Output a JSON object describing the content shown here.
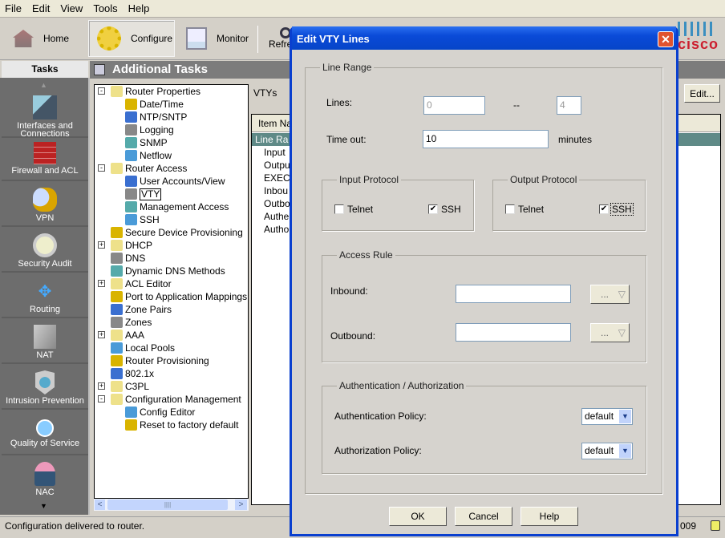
{
  "menu": [
    "File",
    "Edit",
    "View",
    "Tools",
    "Help"
  ],
  "toolbar": {
    "home": "Home",
    "configure": "Configure",
    "monitor": "Monitor",
    "refresh": "Refresh"
  },
  "logo": "cisco",
  "tasks_header": "Tasks",
  "sidebar": [
    {
      "label": "Interfaces and Connections",
      "icon": "interfaces-icon"
    },
    {
      "label": "Firewall and ACL",
      "icon": "firewall-icon"
    },
    {
      "label": "VPN",
      "icon": "vpn-icon"
    },
    {
      "label": "Security Audit",
      "icon": "security-audit-icon"
    },
    {
      "label": "Routing",
      "icon": "routing-icon"
    },
    {
      "label": "NAT",
      "icon": "nat-icon"
    },
    {
      "label": "Intrusion Prevention",
      "icon": "ips-icon"
    },
    {
      "label": "Quality of Service",
      "icon": "qos-icon"
    },
    {
      "label": "NAC",
      "icon": "nac-icon"
    }
  ],
  "panel_title": "Additional Tasks",
  "tree": [
    {
      "label": "Router Properties",
      "level": 0,
      "expander": "-"
    },
    {
      "label": "Date/Time",
      "level": 1
    },
    {
      "label": "NTP/SNTP",
      "level": 1
    },
    {
      "label": "Logging",
      "level": 1
    },
    {
      "label": "SNMP",
      "level": 1
    },
    {
      "label": "Netflow",
      "level": 1
    },
    {
      "label": "Router Access",
      "level": 0,
      "expander": "-"
    },
    {
      "label": "User Accounts/View",
      "level": 1
    },
    {
      "label": "VTY",
      "level": 1,
      "selected": true
    },
    {
      "label": "Management Access",
      "level": 1
    },
    {
      "label": "SSH",
      "level": 1
    },
    {
      "label": "Secure Device Provisioning",
      "level": 0
    },
    {
      "label": "DHCP",
      "level": 0,
      "expander": "+"
    },
    {
      "label": "DNS",
      "level": 0
    },
    {
      "label": "Dynamic DNS Methods",
      "level": 0
    },
    {
      "label": "ACL Editor",
      "level": 0,
      "expander": "+"
    },
    {
      "label": "Port to Application Mappings",
      "level": 0
    },
    {
      "label": "Zone Pairs",
      "level": 0
    },
    {
      "label": "Zones",
      "level": 0
    },
    {
      "label": "AAA",
      "level": 0,
      "expander": "+"
    },
    {
      "label": "Local Pools",
      "level": 0
    },
    {
      "label": "Router Provisioning",
      "level": 0
    },
    {
      "label": "802.1x",
      "level": 0
    },
    {
      "label": "C3PL",
      "level": 0,
      "expander": "+"
    },
    {
      "label": "Configuration Management",
      "level": 0,
      "expander": "-"
    },
    {
      "label": "Config Editor",
      "level": 1
    },
    {
      "label": "Reset to factory default",
      "level": 1
    }
  ],
  "vty_panel": {
    "title": "VTYs",
    "edit": "Edit...",
    "column": "Item Na",
    "rows": [
      "Line Ra",
      "Input",
      "Outpu",
      "EXEC",
      "Inbou",
      "Outbo",
      "Authe",
      "Autho"
    ]
  },
  "status": {
    "message": "Configuration delivered to router.",
    "right": "009"
  },
  "dialog": {
    "title": "Edit VTY Lines",
    "line_range": "Line Range",
    "lines_label": "Lines:",
    "line_from": "0",
    "sep": "--",
    "line_to": "4",
    "timeout_label": "Time out:",
    "timeout": "10",
    "minutes": "minutes",
    "input_protocol": {
      "title": "Input Protocol",
      "telnet": "Telnet",
      "telnet_checked": false,
      "ssh": "SSH",
      "ssh_checked": true
    },
    "output_protocol": {
      "title": "Output Protocol",
      "telnet": "Telnet",
      "telnet_checked": false,
      "ssh": "SSH",
      "ssh_checked": true
    },
    "access_rule": {
      "title": "Access Rule",
      "inbound": "Inbound:",
      "inbound_value": "",
      "outbound": "Outbound:",
      "outbound_value": "",
      "browse": "..."
    },
    "auth": {
      "title": "Authentication / Authorization",
      "authn": "Authentication Policy:",
      "authn_value": "default",
      "authz": "Authorization Policy:",
      "authz_value": "default"
    },
    "ok": "OK",
    "cancel": "Cancel",
    "help": "Help"
  },
  "colors": {
    "titlebar": "#0a4ad8",
    "selected_row": "#5f8a87",
    "sidebar": "#6d6d6d",
    "cisco_red": "#cc1f2f"
  }
}
